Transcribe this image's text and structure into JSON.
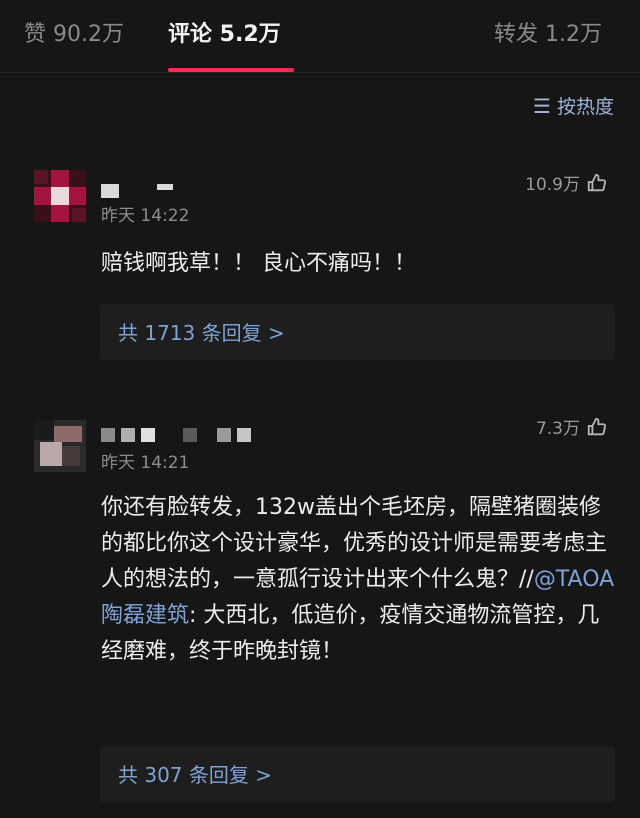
{
  "tabs": [
    {
      "label": "赞 90.2万"
    },
    {
      "label": "评论 5.2万"
    },
    {
      "label": "转发 1.2万"
    }
  ],
  "sort": {
    "label": "按热度",
    "icon": "sort-icon"
  },
  "comments": [
    {
      "time": "昨天 14:22",
      "likes": "10.9万",
      "text": "赔钱啊我草！！ 良心不痛吗！！",
      "replies": "共 1713 条回复 >"
    },
    {
      "time": "昨天 14:21",
      "likes": "7.3万",
      "text_before_mention": "你还有脸转发，132w盖出个毛坯房，隔壁猪圈装修的都比你这个设计豪华，优秀的设计师是需要考虑主人的想法的，一意孤行设计出来个什么鬼？//",
      "mention": "@TAOA 陶磊建筑",
      "text_after_mention": ": 大西北，低造价，疫情交通物流管控，几经磨难，终于昨晚封镜！",
      "replies": "共 307 条回复 >"
    }
  ],
  "colors": {
    "accent": "#fe2c55",
    "link": "#7ea2d6",
    "background": "#161616"
  }
}
